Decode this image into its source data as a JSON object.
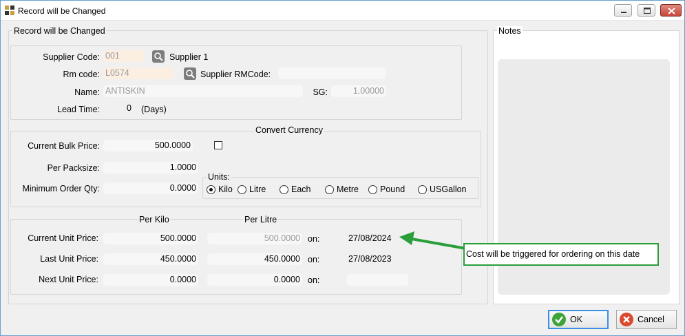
{
  "window": {
    "title": "Record will be Changed"
  },
  "main_group": {
    "legend": "Record will be Changed"
  },
  "notes_group": {
    "legend": "Notes"
  },
  "supplier": {
    "code_label": "Supplier Code:",
    "code_value": "001",
    "name_value": "Supplier 1",
    "rm_label": "Rm code:",
    "rm_value": "L0574",
    "supplier_rm_label": "Supplier RMCode:",
    "supplier_rm_value": "",
    "name_label": "Name:",
    "name_field_value": "ANTISKIN",
    "sg_label": "SG:",
    "sg_value": "1.00000",
    "lead_label": "Lead Time:",
    "lead_value": "0",
    "lead_unit": "(Days)"
  },
  "currency": {
    "legend": "Convert Currency",
    "bulk_label": "Current Bulk Price:",
    "bulk_value": "500.0000",
    "pack_label": "Per Packsize:",
    "pack_value": "1.0000",
    "moq_label": "Minimum Order Qty:",
    "moq_value": "0.0000",
    "units_label": "Units:",
    "units": [
      {
        "label": "Kilo",
        "selected": true
      },
      {
        "label": "Litre",
        "selected": false
      },
      {
        "label": "Each",
        "selected": false
      },
      {
        "label": "Metre",
        "selected": false
      },
      {
        "label": "Pound",
        "selected": false
      },
      {
        "label": "USGallon",
        "selected": false
      }
    ]
  },
  "prices": {
    "per_kilo_header": "Per Kilo",
    "per_litre_header": "Per Litre",
    "current_label": "Current Unit Price:",
    "current_kilo": "500.0000",
    "current_litre": "500.0000",
    "current_on": "on:",
    "current_date": "27/08/2024",
    "last_label": "Last Unit Price:",
    "last_kilo": "450.0000",
    "last_litre": "450.0000",
    "last_on": "on:",
    "last_date": "27/08/2023",
    "next_label": "Next Unit Price:",
    "next_kilo": "0.0000",
    "next_litre": "0.0000",
    "next_on": "on:",
    "next_date": ""
  },
  "annotation": {
    "text": "Cost will be triggered for ordering on this date",
    "color": "#2a9e3a"
  },
  "buttons": {
    "ok": "OK",
    "cancel": "Cancel"
  }
}
